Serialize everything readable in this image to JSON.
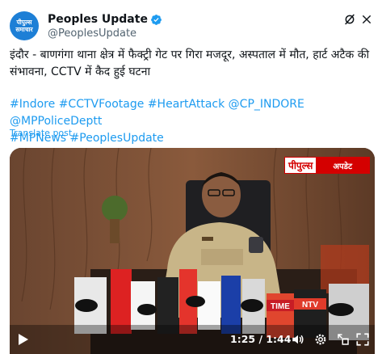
{
  "header": {
    "avatar_text_line1": "पीपुल्स",
    "avatar_text_line2": "समाचार",
    "display_name": "Peoples Update",
    "handle": "@PeoplesUpdate"
  },
  "tweet": {
    "text": "इंदौर - बाणगंगा थाना क्षेत्र में फैक्ट्री गेट पर गिरा मजदूर, अस्पताल में मौत, हार्ट अटैक की संभावना, CCTV में कैद हुई घटना",
    "hashtags": [
      "#Indore",
      "#CCTVFootage",
      "#HeartAttack",
      "@CP_INDORE",
      "@MPPoliceDeptt",
      "#MPNews",
      "#PeoplesUpdate"
    ],
    "translate_label": "Translate post"
  },
  "video": {
    "watermark_part1": "पीपुल्स",
    "watermark_part2": "अपडेट",
    "mic_labels": [
      "TIME",
      "NTV"
    ],
    "time": "1:25 / 1:44"
  },
  "icons": {
    "verified": "verified-badge-icon",
    "grok": "grok-icon",
    "close": "close-icon",
    "play": "play-icon",
    "volume": "volume-icon",
    "settings": "settings-icon",
    "exit_fullscreen": "exit-fullscreen-icon",
    "fullscreen": "fullscreen-icon"
  },
  "colors": {
    "accent": "#1d9bf0",
    "brand_red": "#d40000",
    "avatar_bg": "#1d7fd6"
  }
}
